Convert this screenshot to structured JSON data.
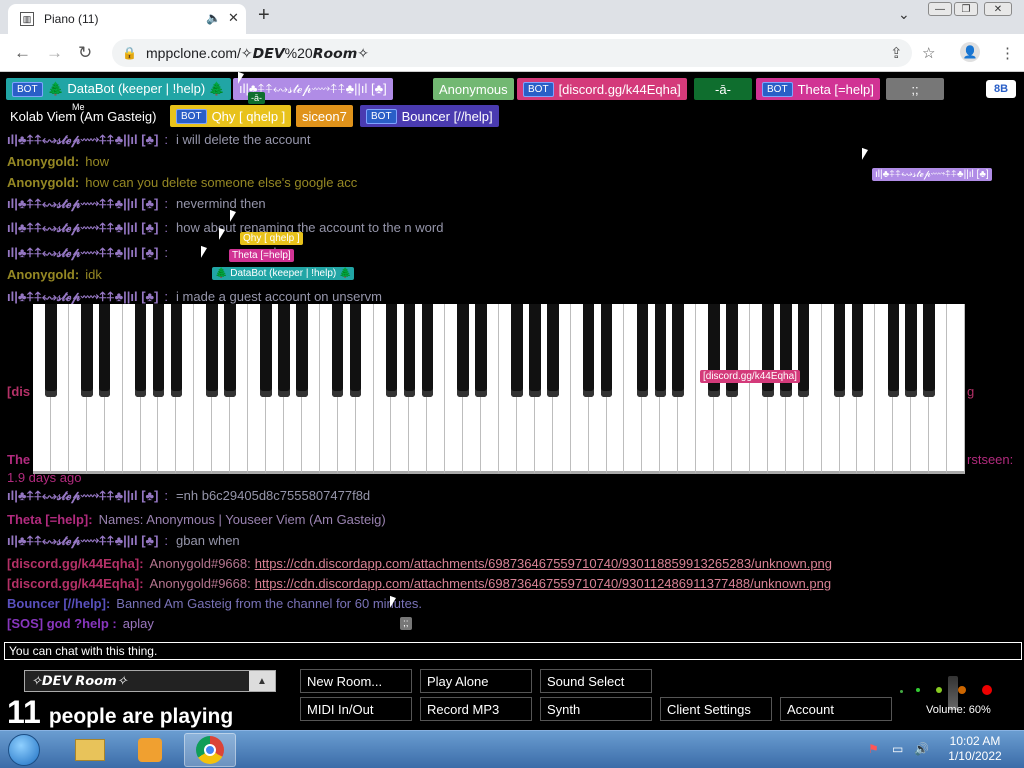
{
  "browser": {
    "tab_title": "Piano (11)",
    "url": "mppclone.com/✧𝘿𝙀𝙑%20𝙍𝙤𝙤𝙢✧",
    "icons": [
      "back-icon",
      "forward-icon",
      "reload-icon",
      "lock-icon",
      "share-icon",
      "star-icon",
      "profile-icon",
      "kebab-menu-icon"
    ]
  },
  "users": [
    {
      "label": "🌲 DataBot (keeper | !help) 🌲",
      "bot": true,
      "color": "#21a5a5"
    },
    {
      "label": "ıl|♣⍏⍏↭𝓈𝓉ℯ𝓅⟿⍏⍏♣||ıl [♣]",
      "bot": false,
      "color": "#b08ce6"
    },
    {
      "label": "Anonymous",
      "bot": false,
      "color": "#72b872"
    },
    {
      "label": "[discord.gg/k44Eqha]",
      "bot": true,
      "color": "#d43a7a"
    },
    {
      "label": "-ā-",
      "bot": false,
      "color": "#0f6e2e"
    },
    {
      "label": "Theta [=help]",
      "bot": true,
      "color": "#d13394"
    },
    {
      "label": ";;",
      "bot": false,
      "color": "#777777"
    },
    {
      "label": "8B",
      "bot": false,
      "color": "#ffffff"
    },
    {
      "label": "Kolab Viem (Am Gasteig)",
      "bot": false,
      "color": "#000000"
    },
    {
      "label": "Qhy [ qhelp ]",
      "bot": true,
      "color": "#e8c21b"
    },
    {
      "label": "siceon7",
      "bot": false,
      "color": "#e0931b"
    },
    {
      "label": "Bouncer [//help]",
      "bot": true,
      "color": "#4a3bb0"
    }
  ],
  "me_tag": "Me",
  "bot_badge": "BOT",
  "chat": [
    {
      "name": "ıl|♣⍏⍏↭𝓈𝓉ℯ𝓅⟿⍏⍏♣||ıl [♣]",
      "sep": ":",
      "text": "i will delete the account",
      "color": "#b08ce6"
    },
    {
      "name": "Anonygold:",
      "sep": "",
      "text": "how",
      "color": "#b0a02b"
    },
    {
      "name": "Anonygold:",
      "sep": "",
      "text": "how can you delete someone else's google acc",
      "color": "#b0a02b"
    },
    {
      "name": "ıl|♣⍏⍏↭𝓈𝓉ℯ𝓅⟿⍏⍏♣||ıl [♣]",
      "sep": ":",
      "text": "nevermind then",
      "color": "#b08ce6"
    },
    {
      "name": "ıl|♣⍏⍏↭𝓈𝓉ℯ𝓅⟿⍏⍏♣||ıl [♣]",
      "sep": ":",
      "text": "how about renaming the account to the n word",
      "color": "#b08ce6"
    },
    {
      "name": "ıl|♣⍏⍏↭𝓈𝓉ℯ𝓅⟿⍏⍏♣||ıl [♣]",
      "sep": ":",
      "text": "e can ba-",
      "color": "#b08ce6"
    },
    {
      "name": "Anonygold:",
      "sep": "",
      "text": "idk",
      "color": "#b0a02b"
    },
    {
      "name": "ıl|♣⍏⍏↭𝓈𝓉ℯ𝓅⟿⍏⍏♣||ıl [♣]",
      "sep": ":",
      "text": "i made a guest account on unservm",
      "color": "#b08ce6"
    },
    {
      "name": "ıl|♣⍏⍏↭𝓈𝓉ℯ𝓅⟿⍏⍏♣||ıl [♣]",
      "sep": ":",
      "text": "=nh b6c29405d8c7555807477f8d",
      "color": "#b08ce6"
    },
    {
      "name": "Theta [=help]:",
      "sep": "",
      "text": "Names: Anonymous | Youseer Viem (Am Gasteig)",
      "color": "#d13394"
    },
    {
      "name": "ıl|♣⍏⍏↭𝓈𝓉ℯ𝓅⟿⍏⍏♣||ıl [♣]",
      "sep": ":",
      "text": "gban when",
      "color": "#b08ce6"
    },
    {
      "name": "[discord.gg/k44Eqha]:",
      "sep": "",
      "text": "Anonygold#9668:",
      "link": "https://cdn.discordapp.com/attachments/698736467559710740/930118859913265283/unknown.png",
      "color": "#d43a7a"
    },
    {
      "name": "[discord.gg/k44Eqha]:",
      "sep": "",
      "text": "Anonygold#9668:",
      "link": "https://cdn.discordapp.com/attachments/698736467559710740/930112486911377488/unknown.png",
      "color": "#d43a7a"
    },
    {
      "name": "Bouncer [//help]:",
      "sep": "",
      "text": "Banned Am Gasteig from the channel for 60 minutes.",
      "color": "#6a5fe0"
    },
    {
      "name": "[SOS] god ?help :",
      "sep": "",
      "text": "aplay",
      "color": "#a040e0"
    }
  ],
  "partial": {
    "left1": "[dis",
    "left2": "The",
    "right1": "g",
    "right2": "rstseen:",
    "tail": "1.9 days ago"
  },
  "cursor_labels": [
    {
      "text": "Qhy [ qhelp ]",
      "color": "#e8c21b"
    },
    {
      "text": "Theta [=help]",
      "color": "#d13394"
    },
    {
      "text": "🌲 DataBot (keeper | !help) 🌲",
      "color": "#21a5a5"
    },
    {
      "text": "[discord.gg/k44Eqha]",
      "color": "#d43a7a"
    },
    {
      "text": "ıl|♣⍏⍏↭𝓈𝓉ℯ𝓅⟿⍏⍏♣||ıl [♣]",
      "color": "#b08ce6"
    },
    {
      "text": ";;",
      "color": "#777777"
    },
    {
      "text": "-ā-",
      "color": "#0f6e2e"
    }
  ],
  "chat_input": {
    "placeholder": "You can chat with this thing."
  },
  "room": {
    "name": "✧𝘿𝙀𝙑 𝙍𝙤𝙤𝙢✧"
  },
  "people": {
    "count": "11",
    "label": "people are playing"
  },
  "buttons": {
    "new_room": "New Room...",
    "play_alone": "Play Alone",
    "sound_select": "Sound Select",
    "midi": "MIDI In/Out",
    "record": "Record MP3",
    "synth": "Synth",
    "client_settings": "Client Settings",
    "account": "Account"
  },
  "volume": {
    "label": "Volume: 60%"
  },
  "taskbar": {
    "time": "10:02 AM",
    "date": "1/10/2022"
  }
}
